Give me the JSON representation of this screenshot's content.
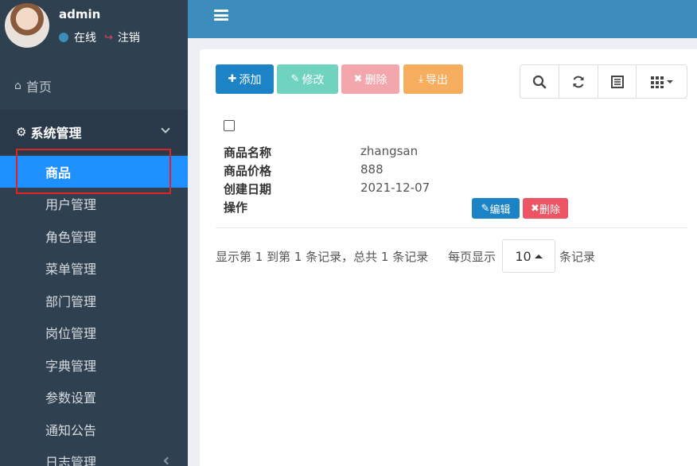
{
  "user": {
    "name": "admin",
    "status": "在线",
    "logout": "注销"
  },
  "nav": {
    "home": "首页",
    "group": "系统管理",
    "items": [
      "商品",
      "用户管理",
      "角色管理",
      "菜单管理",
      "部门管理",
      "岗位管理",
      "字典管理",
      "参数设置",
      "通知公告",
      "日志管理"
    ],
    "active_index": 0
  },
  "toolbar": {
    "add": "添加",
    "edit": "修改",
    "delete": "删除",
    "export": "导出"
  },
  "record": {
    "fields": [
      {
        "label": "商品名称",
        "value": "zhangsan"
      },
      {
        "label": "商品价格",
        "value": "888"
      },
      {
        "label": "创建日期",
        "value": "2021-12-07"
      },
      {
        "label": "操作",
        "value": ""
      }
    ],
    "edit_button": "编辑",
    "delete_button": "删除"
  },
  "pagination": {
    "summary": "显示第 1 到第 1 条记录，总共 1 条记录",
    "per_page_prefix": "每页显示",
    "per_page_value": "10",
    "per_page_suffix": "条记录"
  },
  "colors": {
    "sidebar_bg": "#2f4050",
    "header_bg": "#3c8dbc",
    "active_item": "#1e90ff",
    "btn_add": "#1c84c6",
    "btn_edit": "#6fd3c0",
    "btn_delete": "#f3a7ac",
    "btn_export": "#f6ad5d",
    "highlight_box": "#e32222"
  }
}
